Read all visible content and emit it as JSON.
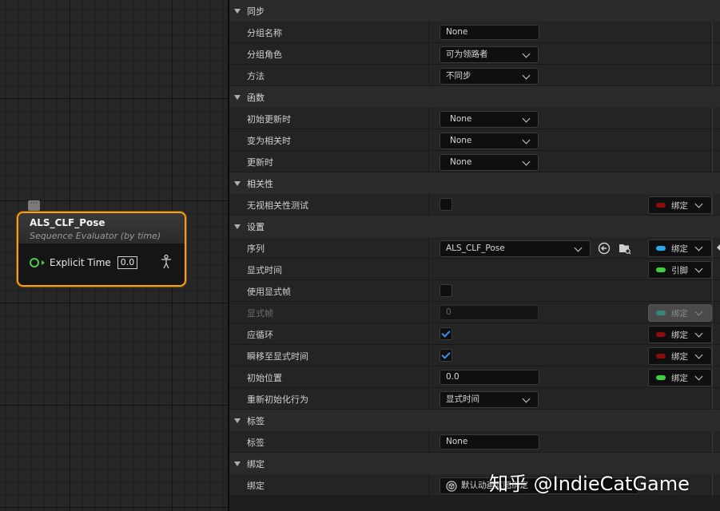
{
  "node": {
    "title": "ALS_CLF_Pose",
    "subtitle": "Sequence Evaluator (by time)",
    "pin_label": "Explicit Time",
    "pin_value": "0.0",
    "comment_icon": "comment-bubble-icon",
    "accent_color": "#f0a020"
  },
  "details": {
    "sync": {
      "header": "同步",
      "group_name_label": "分组名称",
      "group_name_value": "None",
      "group_role_label": "分组角色",
      "group_role_value": "可为领路者",
      "method_label": "方法",
      "method_value": "不同步"
    },
    "functions": {
      "header": "函数",
      "initial_update_label": "初始更新时",
      "initial_update_value": "None",
      "become_relevant_label": "变为相关时",
      "become_relevant_value": "None",
      "update_label": "更新时",
      "update_value": "None"
    },
    "relevance": {
      "header": "相关性",
      "ignore_test_label": "无视相关性测试",
      "bind_label": "绑定"
    },
    "settings": {
      "header": "设置",
      "sequence_label": "序列",
      "sequence_value": "ALS_CLF_Pose",
      "sequence_bind": "绑定",
      "explicit_time_label": "显式时间",
      "explicit_time_bind": "引脚",
      "use_explicit_frame_label": "使用显式帧",
      "explicit_frame_label": "显式帧",
      "explicit_frame_value": "0",
      "explicit_frame_bind": "绑定",
      "should_loop_label": "应循环",
      "should_loop_bind": "绑定",
      "teleport_label": "瞬移至显式时间",
      "teleport_bind": "绑定",
      "start_position_label": "初始位置",
      "start_position_value": "0.0",
      "start_position_bind": "绑定",
      "reinit_label": "重新初始化行为",
      "reinit_value": "显式时间"
    },
    "tags": {
      "header": "标签",
      "tag_label": "标签",
      "tag_value": "None"
    },
    "binding": {
      "header": "绑定",
      "binding_label": "绑定",
      "binding_value": "默认动画蓝图绑定"
    }
  },
  "colors": {
    "bind_red": "#8b0d0d",
    "bind_blue": "#2aa8e8",
    "bind_green": "#3ecf3e",
    "bind_teal": "#2e8a7a",
    "check_blue": "#3f8ee8"
  },
  "watermark": "知乎 @IndieCatGame"
}
